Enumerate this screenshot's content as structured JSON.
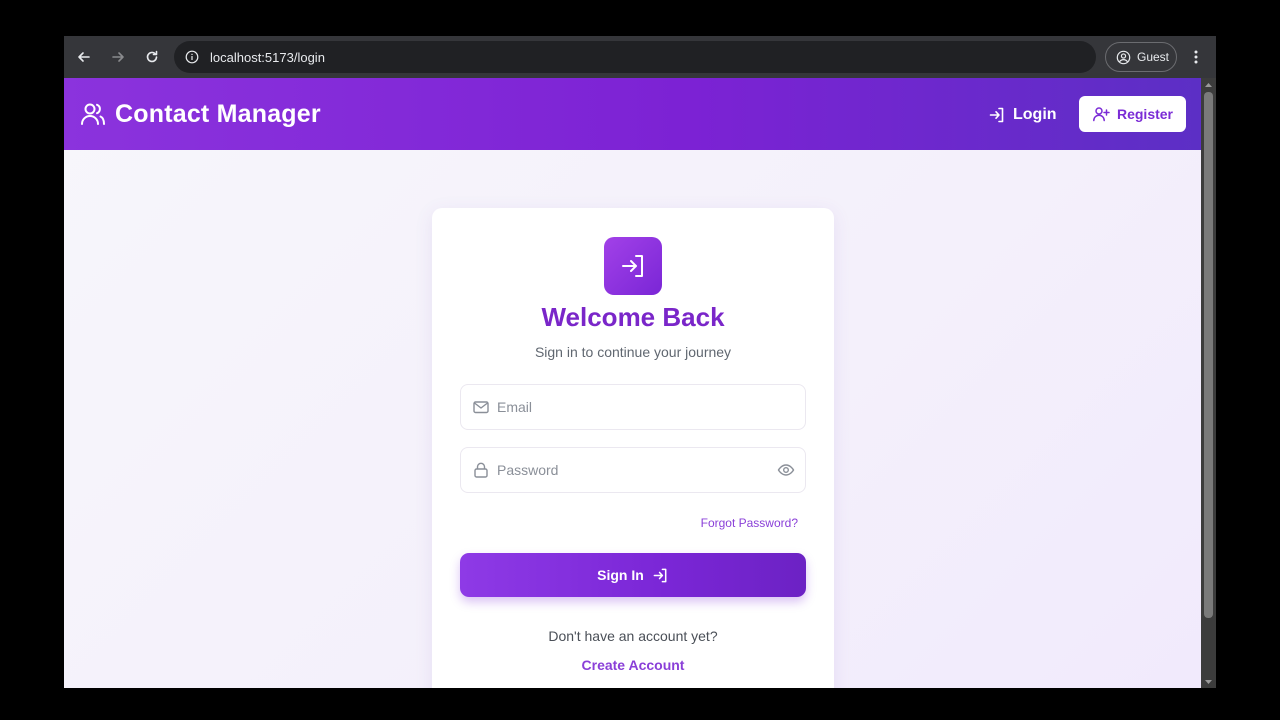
{
  "browser": {
    "url": "localhost:5173/login",
    "profile_label": "Guest",
    "icons": [
      "back-arrow-icon",
      "forward-arrow-icon",
      "reload-icon",
      "site-info-icon",
      "profile-icon",
      "more-menu-icon"
    ]
  },
  "header": {
    "brand_title": "Contact Manager",
    "login_label": "Login",
    "register_label": "Register",
    "colors": {
      "gradient_start": "#8b33dd",
      "gradient_end": "#5c2fc5"
    }
  },
  "card": {
    "title": "Welcome Back",
    "subtitle": "Sign in to continue your journey",
    "email": {
      "placeholder": "Email",
      "value": ""
    },
    "password": {
      "placeholder": "Password",
      "value": ""
    },
    "forgot_password": "Forgot Password?",
    "signin_label": "Sign In",
    "no_account_text": "Don't have an account yet?",
    "create_account_label": "Create Account",
    "colors": {
      "accent": "#7a26d6",
      "title": "#7a26c9"
    }
  }
}
